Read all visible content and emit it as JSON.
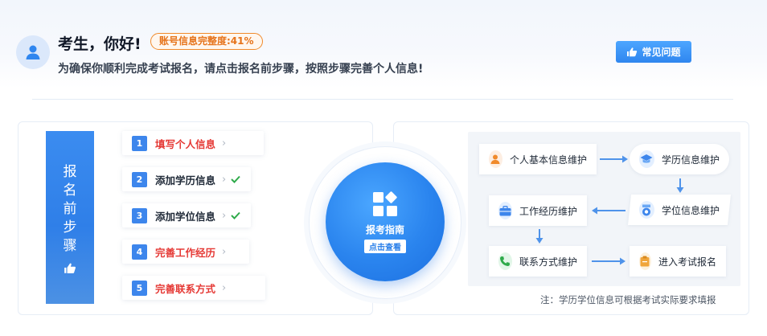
{
  "header": {
    "greeting": "考生，你好!",
    "completeness_badge": "账号信息完整度:41%",
    "subtitle": "为确保你顺利完成考试报名，请点击报名前步骤，按照步骤完善个人信息!",
    "faq_button": "常见问题"
  },
  "steps_banner": {
    "chars": [
      "报",
      "名",
      "前",
      "步",
      "骤"
    ]
  },
  "steps": [
    {
      "num": "1",
      "label": "填写个人信息",
      "status": "incomplete",
      "color": "#e53935"
    },
    {
      "num": "2",
      "label": "添加学历信息",
      "status": "complete",
      "color": "#1f2937"
    },
    {
      "num": "3",
      "label": "添加学位信息",
      "status": "complete",
      "color": "#1f2937"
    },
    {
      "num": "4",
      "label": "完善工作经历",
      "status": "incomplete",
      "color": "#e53935"
    },
    {
      "num": "5",
      "label": "完善联系方式",
      "status": "incomplete",
      "color": "#e53935"
    }
  ],
  "guide": {
    "title": "报考指南",
    "button": "点击查看"
  },
  "flow": {
    "nodes": {
      "personal": "个人基本信息维护",
      "education": "学历信息维护",
      "degree": "学位信息维护",
      "work": "工作经历维护",
      "contact": "联系方式维护",
      "enter": "进入考试报名"
    }
  },
  "note": "注：学历学位信息可根据考试实际要求填报",
  "colors": {
    "primary": "#2f86ef",
    "warning": "#e53935",
    "badge": "#f08a2b",
    "success": "#2eaa4a"
  }
}
